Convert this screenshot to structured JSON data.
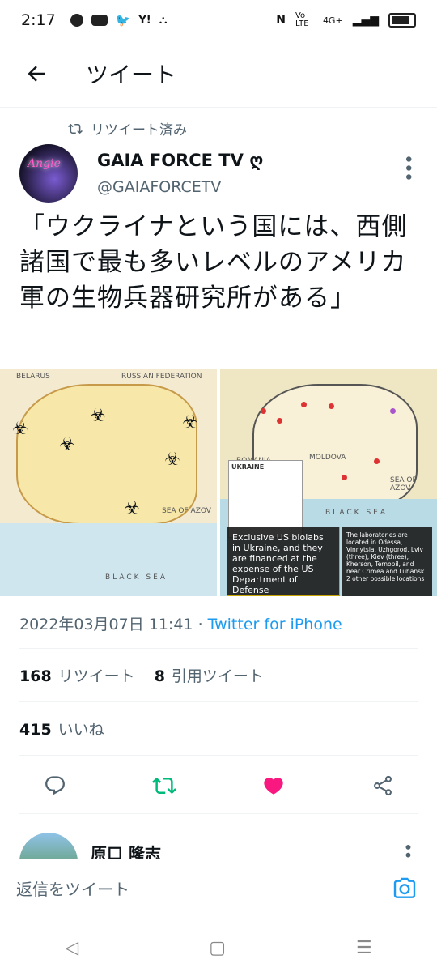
{
  "status": {
    "time": "2:17",
    "network": "4G+",
    "volte": "Vo LTE",
    "icons": [
      "facebook-icon",
      "youtube-icon",
      "twitter-icon",
      "yahoo-icon",
      "app-icon"
    ]
  },
  "header": {
    "back_icon": "arrow-left-icon",
    "title": "ツイート"
  },
  "tweet": {
    "retweet_label": "リツイート済み",
    "avatar_text": "Angie",
    "display_name": "GAIA FORCE TV ღ",
    "handle": "@GAIAFORCETV",
    "text": "「ウクライナという国には、西側諸国で最も多いレベルのアメリカ軍の生物兵器研究所がある」",
    "media": {
      "left_labels": [
        "BELARUS",
        "RUSSIAN FEDERATION",
        "BLACK SEA",
        "SEA OF AZOV"
      ],
      "right_labels": [
        "UKRAINE",
        "BLACK SEA",
        "SEA OF AZOV",
        "ROMANIA",
        "MOLDOVA"
      ],
      "caption_left": "Exclusive US biolabs in Ukraine, and they are financed at the expense of the US Department of Defense",
      "caption_right": "The laboratories are located in Odessa, Vinnytsia, Uzhgorod, Lviv (three), Kiev (three), Kherson, Ternopil, and near Crimea and Luhansk. 2 other possible locations"
    },
    "datetime": "2022年03月07日 11:41",
    "separator": "·",
    "source": "Twitter for iPhone",
    "retweets_count": "168",
    "retweets_label": "リツイート",
    "quotes_count": "8",
    "quotes_label": "引用ツイート",
    "likes_count": "415",
    "likes_label": "いいね"
  },
  "actions": {
    "reply_icon": "comment-icon",
    "retweet_icon": "retweet-icon",
    "like_icon": "heart-icon",
    "share_icon": "share-icon",
    "retweet_color": "#00ba7c",
    "like_color": "#f91880"
  },
  "reply": {
    "name": "原口 隆志"
  },
  "composer": {
    "placeholder": "返信をツイート"
  },
  "navbar": {
    "back": "◁",
    "home": "▢",
    "menu": "☰"
  }
}
